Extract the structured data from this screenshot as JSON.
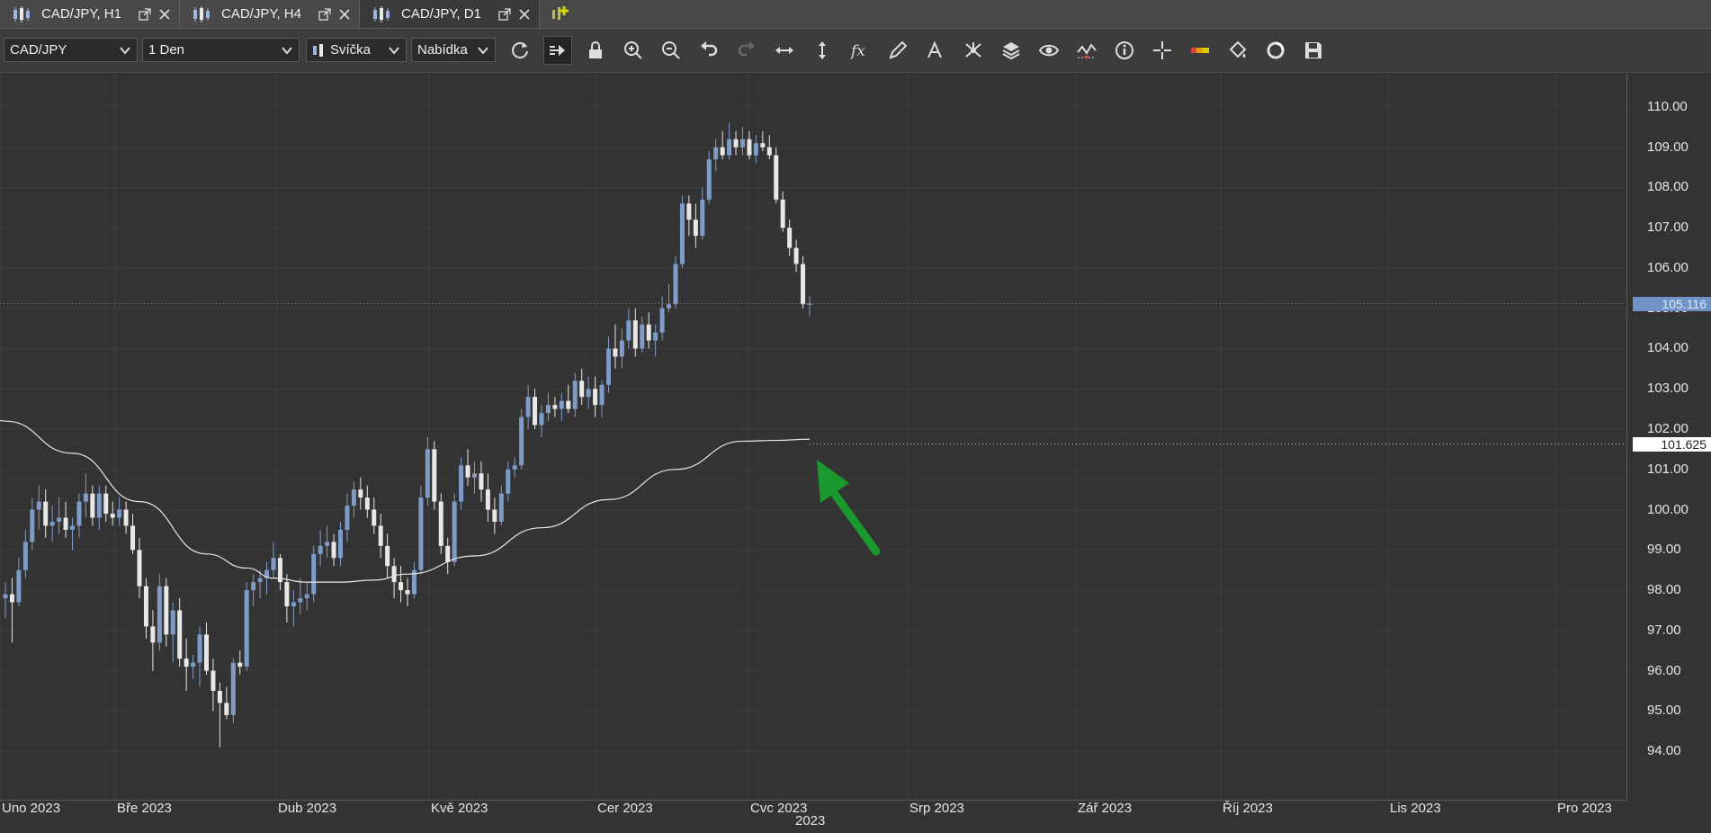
{
  "tabs": [
    {
      "label": "CAD/JPY, H1",
      "active": false
    },
    {
      "label": "CAD/JPY, H4",
      "active": false
    },
    {
      "label": "CAD/JPY, D1",
      "active": true
    }
  ],
  "toolbar": {
    "symbol": "CAD/JPY",
    "timeframe": "1 Den",
    "chart_type": "Svíčka",
    "price_side": "Nabídka",
    "icons": [
      "refresh-icon",
      "chart-shift-icon",
      "lock-icon",
      "zoom-in-icon",
      "zoom-out-icon",
      "undo-icon",
      "redo-icon",
      "horizontal-scale-icon",
      "vertical-scale-icon",
      "indicator-fx-icon",
      "pencil-icon",
      "text-icon",
      "pattern-icon",
      "layers-icon",
      "eye-icon",
      "oscillator-icon",
      "info-icon",
      "crosshair-icon",
      "color-bar-icon",
      "paint-bucket-icon",
      "record-icon",
      "save-icon"
    ]
  },
  "colors": {
    "bull": "#7f9cc8",
    "bear": "#e8e8e8",
    "ma": "#e8e8e8",
    "arrow": "#1a9a2e",
    "price_tag_bg": "#6f93c7",
    "ma_tag_bg": "#ffffff"
  },
  "chart_data": {
    "type": "candlestick",
    "symbol": "CAD/JPY",
    "timeframe": "D1",
    "ylim": [
      93.4,
      110.4
    ],
    "y_ticks": [
      "110.00",
      "109.00",
      "108.00",
      "107.00",
      "106.00",
      "105.00",
      "104.00",
      "103.00",
      "102.00",
      "101.00",
      "100.00",
      "99.00",
      "98.00",
      "97.00",
      "96.00",
      "95.00",
      "94.00"
    ],
    "x_ticks": [
      "Uno 2023",
      "Bře 2023",
      "Dub 2023",
      "Kvě 2023",
      "Cer 2023",
      "Cvc 2023",
      "Srp 2023",
      "Zář 2023",
      "Říj 2023",
      "Lis 2023",
      "Pro 2023"
    ],
    "year_label": "2023",
    "last_price": "105.116",
    "ma_value": "101.625",
    "candles": [
      [
        97.8,
        98.2,
        97.3,
        97.9
      ],
      [
        97.9,
        98.3,
        96.7,
        97.7
      ],
      [
        97.7,
        98.8,
        97.6,
        98.5
      ],
      [
        98.5,
        99.5,
        98.3,
        99.2
      ],
      [
        99.2,
        100.3,
        99.0,
        100.0
      ],
      [
        100.0,
        100.6,
        99.5,
        100.2
      ],
      [
        100.2,
        100.5,
        99.3,
        99.6
      ],
      [
        99.6,
        100.1,
        99.2,
        99.7
      ],
      [
        99.7,
        100.3,
        99.4,
        99.8
      ],
      [
        99.8,
        100.2,
        99.3,
        99.5
      ],
      [
        99.5,
        99.8,
        99.0,
        99.6
      ],
      [
        99.6,
        100.4,
        99.3,
        100.2
      ],
      [
        100.2,
        100.9,
        99.8,
        100.4
      ],
      [
        100.4,
        100.6,
        99.6,
        99.8
      ],
      [
        99.8,
        100.6,
        99.5,
        100.4
      ],
      [
        100.4,
        100.6,
        99.7,
        99.9
      ],
      [
        99.9,
        100.2,
        99.6,
        99.8
      ],
      [
        99.8,
        100.3,
        99.6,
        100.0
      ],
      [
        100.0,
        100.2,
        99.4,
        99.6
      ],
      [
        99.6,
        99.9,
        98.9,
        99.0
      ],
      [
        99.0,
        99.3,
        97.8,
        98.1
      ],
      [
        98.1,
        98.3,
        96.8,
        97.1
      ],
      [
        97.1,
        97.5,
        96.0,
        96.7
      ],
      [
        96.7,
        98.4,
        96.5,
        98.1
      ],
      [
        98.1,
        98.3,
        96.6,
        96.9
      ],
      [
        96.9,
        97.7,
        96.2,
        97.5
      ],
      [
        97.5,
        97.8,
        96.1,
        96.3
      ],
      [
        96.3,
        96.8,
        95.5,
        96.1
      ],
      [
        96.1,
        96.4,
        95.8,
        96.2
      ],
      [
        96.2,
        97.1,
        95.6,
        96.9
      ],
      [
        96.9,
        97.2,
        95.9,
        96.0
      ],
      [
        96.0,
        96.3,
        95.0,
        95.5
      ],
      [
        95.5,
        95.7,
        94.1,
        95.2
      ],
      [
        95.2,
        95.6,
        94.8,
        94.9
      ],
      [
        94.9,
        96.3,
        94.7,
        96.2
      ],
      [
        96.2,
        96.5,
        95.9,
        96.1
      ],
      [
        96.1,
        98.2,
        96.0,
        98.0
      ],
      [
        98.0,
        98.4,
        97.6,
        98.2
      ],
      [
        98.2,
        98.5,
        97.8,
        98.3
      ],
      [
        98.3,
        98.7,
        97.9,
        98.5
      ],
      [
        98.5,
        99.2,
        98.3,
        98.8
      ],
      [
        98.8,
        98.9,
        98.0,
        98.2
      ],
      [
        98.2,
        98.4,
        97.2,
        97.6
      ],
      [
        97.6,
        98.0,
        97.1,
        97.7
      ],
      [
        97.7,
        98.3,
        97.4,
        97.8
      ],
      [
        97.8,
        98.2,
        97.5,
        97.9
      ],
      [
        97.9,
        99.1,
        97.7,
        98.9
      ],
      [
        98.9,
        99.5,
        98.6,
        99.1
      ],
      [
        99.1,
        99.6,
        98.8,
        99.2
      ],
      [
        99.2,
        99.4,
        98.6,
        98.8
      ],
      [
        98.8,
        99.7,
        98.6,
        99.5
      ],
      [
        99.5,
        100.4,
        99.2,
        100.1
      ],
      [
        100.1,
        100.7,
        99.8,
        100.5
      ],
      [
        100.5,
        100.8,
        100.0,
        100.3
      ],
      [
        100.3,
        100.6,
        99.8,
        100.0
      ],
      [
        100.0,
        100.3,
        99.4,
        99.6
      ],
      [
        99.6,
        99.9,
        98.8,
        99.1
      ],
      [
        99.1,
        99.4,
        98.3,
        98.6
      ],
      [
        98.6,
        98.8,
        97.8,
        98.2
      ],
      [
        98.2,
        98.6,
        97.7,
        98.0
      ],
      [
        98.0,
        98.3,
        97.6,
        97.9
      ],
      [
        97.9,
        98.7,
        97.8,
        98.5
      ],
      [
        98.5,
        100.6,
        98.4,
        100.3
      ],
      [
        100.3,
        101.8,
        100.1,
        101.5
      ],
      [
        101.5,
        101.7,
        100.0,
        100.2
      ],
      [
        100.2,
        100.4,
        98.9,
        99.1
      ],
      [
        99.1,
        99.3,
        98.4,
        98.7
      ],
      [
        98.7,
        100.4,
        98.6,
        100.2
      ],
      [
        100.2,
        101.3,
        100.0,
        101.1
      ],
      [
        101.1,
        101.5,
        100.6,
        100.8
      ],
      [
        100.8,
        101.2,
        100.4,
        100.9
      ],
      [
        100.9,
        101.2,
        100.2,
        100.5
      ],
      [
        100.5,
        100.9,
        99.7,
        100.0
      ],
      [
        100.0,
        100.3,
        99.4,
        99.7
      ],
      [
        99.7,
        100.6,
        99.6,
        100.4
      ],
      [
        100.4,
        101.2,
        100.2,
        101.0
      ],
      [
        101.0,
        101.3,
        100.8,
        101.1
      ],
      [
        101.1,
        102.5,
        101.0,
        102.3
      ],
      [
        102.3,
        103.1,
        102.0,
        102.8
      ],
      [
        102.8,
        103.0,
        102.0,
        102.1
      ],
      [
        102.1,
        102.6,
        101.8,
        102.4
      ],
      [
        102.4,
        102.9,
        102.2,
        102.6
      ],
      [
        102.6,
        102.8,
        102.3,
        102.5
      ],
      [
        102.5,
        102.9,
        102.2,
        102.7
      ],
      [
        102.7,
        103.1,
        102.4,
        102.5
      ],
      [
        102.5,
        103.4,
        102.3,
        103.2
      ],
      [
        103.2,
        103.5,
        102.6,
        102.8
      ],
      [
        102.8,
        103.3,
        102.5,
        103.0
      ],
      [
        103.0,
        103.3,
        102.3,
        102.6
      ],
      [
        102.6,
        103.2,
        102.3,
        103.1
      ],
      [
        103.1,
        104.3,
        102.9,
        104.0
      ],
      [
        104.0,
        104.6,
        103.5,
        103.8
      ],
      [
        103.8,
        104.5,
        103.5,
        104.2
      ],
      [
        104.2,
        105.0,
        104.0,
        104.7
      ],
      [
        104.7,
        105.0,
        103.8,
        104.0
      ],
      [
        104.0,
        104.8,
        103.9,
        104.6
      ],
      [
        104.6,
        104.9,
        104.0,
        104.2
      ],
      [
        104.2,
        104.6,
        103.8,
        104.4
      ],
      [
        104.4,
        105.3,
        104.2,
        105.0
      ],
      [
        105.0,
        105.6,
        104.9,
        105.1
      ],
      [
        105.1,
        106.3,
        105.0,
        106.1
      ],
      [
        106.1,
        107.8,
        106.0,
        107.6
      ],
      [
        107.6,
        107.8,
        106.8,
        107.2
      ],
      [
        107.2,
        107.6,
        106.5,
        106.8
      ],
      [
        106.8,
        108.0,
        106.7,
        107.7
      ],
      [
        107.7,
        108.9,
        107.6,
        108.7
      ],
      [
        108.7,
        109.2,
        108.4,
        109.0
      ],
      [
        109.0,
        109.4,
        108.7,
        108.8
      ],
      [
        108.8,
        109.6,
        108.7,
        109.2
      ],
      [
        109.2,
        109.4,
        108.8,
        109.0
      ],
      [
        109.0,
        109.5,
        108.8,
        109.2
      ],
      [
        109.2,
        109.4,
        108.7,
        108.8
      ],
      [
        108.8,
        109.3,
        108.6,
        109.1
      ],
      [
        109.1,
        109.4,
        108.9,
        109.0
      ],
      [
        109.0,
        109.3,
        108.7,
        108.8
      ],
      [
        108.8,
        109.0,
        107.6,
        107.7
      ],
      [
        107.7,
        107.9,
        106.9,
        107.0
      ],
      [
        107.0,
        107.2,
        106.3,
        106.5
      ],
      [
        106.5,
        106.7,
        105.9,
        106.1
      ],
      [
        106.1,
        106.3,
        105.0,
        105.1
      ],
      [
        105.1,
        105.3,
        104.8,
        105.116
      ]
    ],
    "series": [
      {
        "type": "line",
        "x_index": [
          -4,
          0,
          10,
          20,
          30,
          36,
          40,
          45,
          50,
          55,
          60,
          70,
          80,
          90,
          100,
          110,
          115,
          120
        ],
        "values": [
          102.4,
          102.2,
          101.4,
          100.2,
          98.9,
          98.55,
          98.3,
          98.2,
          98.2,
          98.25,
          98.4,
          98.85,
          99.55,
          100.25,
          101.0,
          101.7,
          101.72,
          101.75
        ]
      }
    ],
    "last_index": 120
  }
}
